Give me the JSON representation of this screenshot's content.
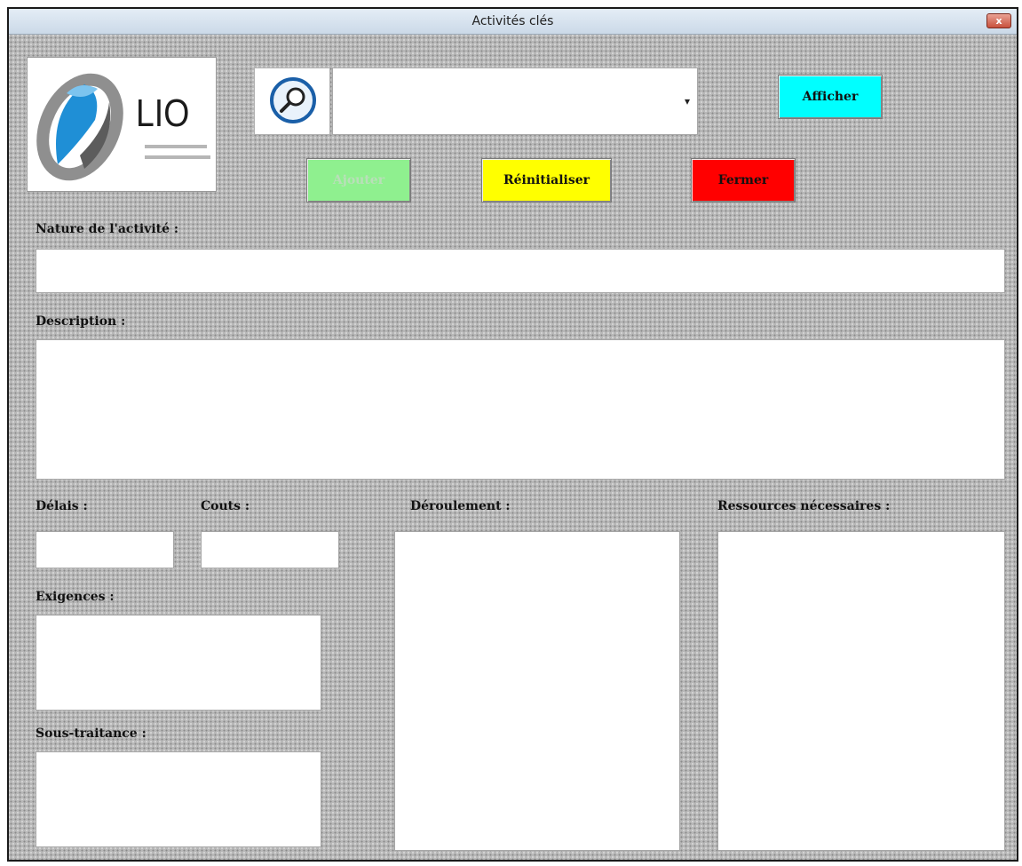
{
  "window": {
    "title": "Activités clés",
    "close_label": "x"
  },
  "logo": {
    "text": "LIO"
  },
  "search": {
    "value": ""
  },
  "buttons": {
    "afficher": "Afficher",
    "ajouter": "Ajouter",
    "reinitialiser": "Réinitialiser",
    "fermer": "Fermer"
  },
  "labels": {
    "nature": "Nature de l'activité :",
    "description": "Description :",
    "delais": "Délais :",
    "couts": "Couts :",
    "deroulement": "Déroulement :",
    "ressources": "Ressources nécessaires :",
    "exigences": "Exigences :",
    "sous_traitance": "Sous-traitance :"
  },
  "fields": {
    "nature": "",
    "description": "",
    "delais": "",
    "couts": "",
    "deroulement": "",
    "ressources": "",
    "exigences": "",
    "sous_traitance": ""
  },
  "colors": {
    "afficher": "#00ffff",
    "ajouter": "#8ff08f",
    "reinitialiser": "#ffff00",
    "fermer": "#ff0000"
  }
}
